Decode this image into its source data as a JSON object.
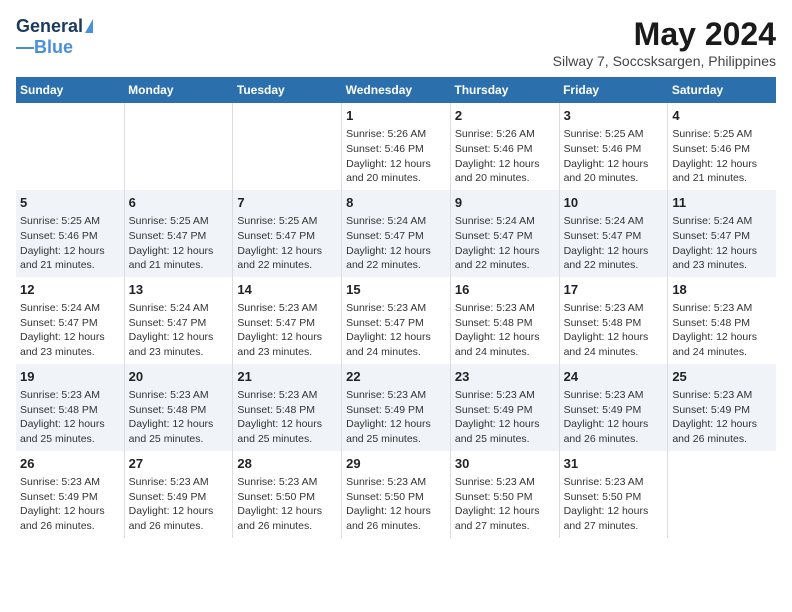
{
  "header": {
    "logo_general": "General",
    "logo_blue": "Blue",
    "main_title": "May 2024",
    "subtitle": "Silway 7, Soccsksargen, Philippines"
  },
  "days_of_week": [
    "Sunday",
    "Monday",
    "Tuesday",
    "Wednesday",
    "Thursday",
    "Friday",
    "Saturday"
  ],
  "weeks": [
    {
      "days": [
        {
          "num": "",
          "lines": []
        },
        {
          "num": "",
          "lines": []
        },
        {
          "num": "",
          "lines": []
        },
        {
          "num": "1",
          "lines": [
            "Sunrise: 5:26 AM",
            "Sunset: 5:46 PM",
            "Daylight: 12 hours",
            "and 20 minutes."
          ]
        },
        {
          "num": "2",
          "lines": [
            "Sunrise: 5:26 AM",
            "Sunset: 5:46 PM",
            "Daylight: 12 hours",
            "and 20 minutes."
          ]
        },
        {
          "num": "3",
          "lines": [
            "Sunrise: 5:25 AM",
            "Sunset: 5:46 PM",
            "Daylight: 12 hours",
            "and 20 minutes."
          ]
        },
        {
          "num": "4",
          "lines": [
            "Sunrise: 5:25 AM",
            "Sunset: 5:46 PM",
            "Daylight: 12 hours",
            "and 21 minutes."
          ]
        }
      ]
    },
    {
      "days": [
        {
          "num": "5",
          "lines": [
            "Sunrise: 5:25 AM",
            "Sunset: 5:46 PM",
            "Daylight: 12 hours",
            "and 21 minutes."
          ]
        },
        {
          "num": "6",
          "lines": [
            "Sunrise: 5:25 AM",
            "Sunset: 5:47 PM",
            "Daylight: 12 hours",
            "and 21 minutes."
          ]
        },
        {
          "num": "7",
          "lines": [
            "Sunrise: 5:25 AM",
            "Sunset: 5:47 PM",
            "Daylight: 12 hours",
            "and 22 minutes."
          ]
        },
        {
          "num": "8",
          "lines": [
            "Sunrise: 5:24 AM",
            "Sunset: 5:47 PM",
            "Daylight: 12 hours",
            "and 22 minutes."
          ]
        },
        {
          "num": "9",
          "lines": [
            "Sunrise: 5:24 AM",
            "Sunset: 5:47 PM",
            "Daylight: 12 hours",
            "and 22 minutes."
          ]
        },
        {
          "num": "10",
          "lines": [
            "Sunrise: 5:24 AM",
            "Sunset: 5:47 PM",
            "Daylight: 12 hours",
            "and 22 minutes."
          ]
        },
        {
          "num": "11",
          "lines": [
            "Sunrise: 5:24 AM",
            "Sunset: 5:47 PM",
            "Daylight: 12 hours",
            "and 23 minutes."
          ]
        }
      ]
    },
    {
      "days": [
        {
          "num": "12",
          "lines": [
            "Sunrise: 5:24 AM",
            "Sunset: 5:47 PM",
            "Daylight: 12 hours",
            "and 23 minutes."
          ]
        },
        {
          "num": "13",
          "lines": [
            "Sunrise: 5:24 AM",
            "Sunset: 5:47 PM",
            "Daylight: 12 hours",
            "and 23 minutes."
          ]
        },
        {
          "num": "14",
          "lines": [
            "Sunrise: 5:23 AM",
            "Sunset: 5:47 PM",
            "Daylight: 12 hours",
            "and 23 minutes."
          ]
        },
        {
          "num": "15",
          "lines": [
            "Sunrise: 5:23 AM",
            "Sunset: 5:47 PM",
            "Daylight: 12 hours",
            "and 24 minutes."
          ]
        },
        {
          "num": "16",
          "lines": [
            "Sunrise: 5:23 AM",
            "Sunset: 5:48 PM",
            "Daylight: 12 hours",
            "and 24 minutes."
          ]
        },
        {
          "num": "17",
          "lines": [
            "Sunrise: 5:23 AM",
            "Sunset: 5:48 PM",
            "Daylight: 12 hours",
            "and 24 minutes."
          ]
        },
        {
          "num": "18",
          "lines": [
            "Sunrise: 5:23 AM",
            "Sunset: 5:48 PM",
            "Daylight: 12 hours",
            "and 24 minutes."
          ]
        }
      ]
    },
    {
      "days": [
        {
          "num": "19",
          "lines": [
            "Sunrise: 5:23 AM",
            "Sunset: 5:48 PM",
            "Daylight: 12 hours",
            "and 25 minutes."
          ]
        },
        {
          "num": "20",
          "lines": [
            "Sunrise: 5:23 AM",
            "Sunset: 5:48 PM",
            "Daylight: 12 hours",
            "and 25 minutes."
          ]
        },
        {
          "num": "21",
          "lines": [
            "Sunrise: 5:23 AM",
            "Sunset: 5:48 PM",
            "Daylight: 12 hours",
            "and 25 minutes."
          ]
        },
        {
          "num": "22",
          "lines": [
            "Sunrise: 5:23 AM",
            "Sunset: 5:49 PM",
            "Daylight: 12 hours",
            "and 25 minutes."
          ]
        },
        {
          "num": "23",
          "lines": [
            "Sunrise: 5:23 AM",
            "Sunset: 5:49 PM",
            "Daylight: 12 hours",
            "and 25 minutes."
          ]
        },
        {
          "num": "24",
          "lines": [
            "Sunrise: 5:23 AM",
            "Sunset: 5:49 PM",
            "Daylight: 12 hours",
            "and 26 minutes."
          ]
        },
        {
          "num": "25",
          "lines": [
            "Sunrise: 5:23 AM",
            "Sunset: 5:49 PM",
            "Daylight: 12 hours",
            "and 26 minutes."
          ]
        }
      ]
    },
    {
      "days": [
        {
          "num": "26",
          "lines": [
            "Sunrise: 5:23 AM",
            "Sunset: 5:49 PM",
            "Daylight: 12 hours",
            "and 26 minutes."
          ]
        },
        {
          "num": "27",
          "lines": [
            "Sunrise: 5:23 AM",
            "Sunset: 5:49 PM",
            "Daylight: 12 hours",
            "and 26 minutes."
          ]
        },
        {
          "num": "28",
          "lines": [
            "Sunrise: 5:23 AM",
            "Sunset: 5:50 PM",
            "Daylight: 12 hours",
            "and 26 minutes."
          ]
        },
        {
          "num": "29",
          "lines": [
            "Sunrise: 5:23 AM",
            "Sunset: 5:50 PM",
            "Daylight: 12 hours",
            "and 26 minutes."
          ]
        },
        {
          "num": "30",
          "lines": [
            "Sunrise: 5:23 AM",
            "Sunset: 5:50 PM",
            "Daylight: 12 hours",
            "and 27 minutes."
          ]
        },
        {
          "num": "31",
          "lines": [
            "Sunrise: 5:23 AM",
            "Sunset: 5:50 PM",
            "Daylight: 12 hours",
            "and 27 minutes."
          ]
        },
        {
          "num": "",
          "lines": []
        }
      ]
    }
  ]
}
